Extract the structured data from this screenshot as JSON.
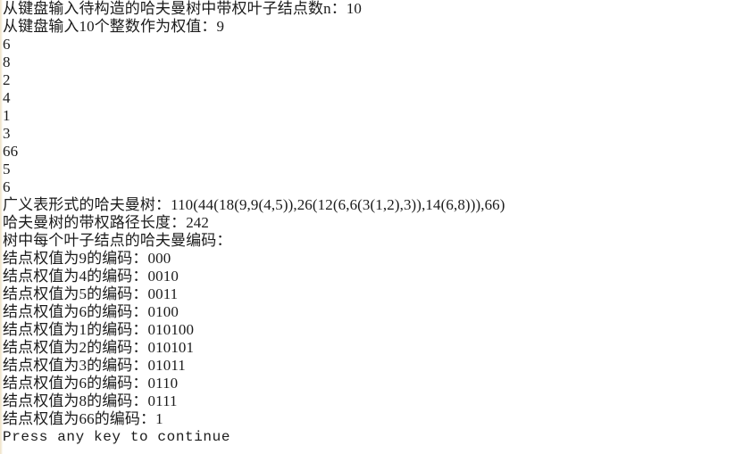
{
  "console": {
    "background_color": "#ffffff",
    "text_color": "#1b1b1b",
    "edge_strip_color": "#efe3c8",
    "prompts": {
      "leaf_count_prompt": "从键盘输入待构造的哈夫曼树中带权叶子结点数n：",
      "leaf_count_value": "10",
      "weights_prompt": "从键盘输入10个整数作为权值：",
      "weights_first_value": "9"
    },
    "echoed_weights": [
      "6",
      "8",
      "2",
      "4",
      "1",
      "3",
      "66",
      "5",
      "6"
    ],
    "glist_label": "广义表形式的哈夫曼树：",
    "glist_value": "110(44(18(9,9(4,5)),26(12(6,6(3(1,2),3)),14(6,8))),66)",
    "wpl_label": "哈夫曼树的带权路径长度：",
    "wpl_value": "242",
    "codes_header": "树中每个叶子结点的哈夫曼编码：",
    "code_lines": [
      {
        "prefix": "结点权值为",
        "weight": "9",
        "suffix": "的编码：",
        "code": "000"
      },
      {
        "prefix": "结点权值为",
        "weight": "4",
        "suffix": "的编码：",
        "code": "0010"
      },
      {
        "prefix": "结点权值为",
        "weight": "5",
        "suffix": "的编码：",
        "code": "0011"
      },
      {
        "prefix": "结点权值为",
        "weight": "6",
        "suffix": "的编码：",
        "code": "0100"
      },
      {
        "prefix": "结点权值为",
        "weight": "1",
        "suffix": "的编码：",
        "code": "010100"
      },
      {
        "prefix": "结点权值为",
        "weight": "2",
        "suffix": "的编码：",
        "code": "010101"
      },
      {
        "prefix": "结点权值为",
        "weight": "3",
        "suffix": "的编码：",
        "code": "01011"
      },
      {
        "prefix": "结点权值为",
        "weight": "6",
        "suffix": "的编码：",
        "code": "0110"
      },
      {
        "prefix": "结点权值为",
        "weight": "8",
        "suffix": "的编码：",
        "code": "0111"
      },
      {
        "prefix": "结点权值为",
        "weight": "66",
        "suffix": "的编码：",
        "code": "1"
      }
    ],
    "pause_message": "Press any key to continue"
  }
}
